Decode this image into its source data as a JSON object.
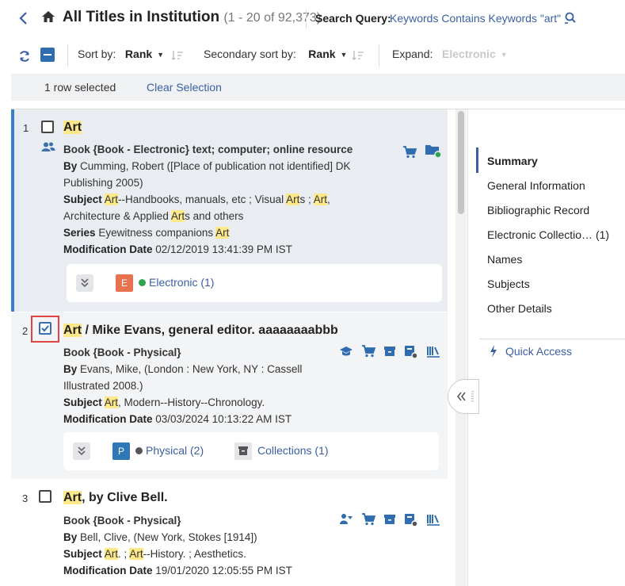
{
  "header": {
    "title": "All Titles in Institution",
    "count": "(1 - 20 of 92,373)",
    "search_query_label": "Search Query:",
    "search_query_value": "Keywords Contains Keywords \"art\""
  },
  "toolbar": {
    "sort_by_label": "Sort by:",
    "sort_by_value": "Rank",
    "secondary_sort_label": "Secondary sort by:",
    "secondary_sort_value": "Rank",
    "expand_label": "Expand:",
    "expand_value": "Electronic"
  },
  "selection": {
    "status": "1 row selected",
    "clear": "Clear Selection"
  },
  "results": [
    {
      "num": "1",
      "title_hl": "Art",
      "title_rest": "",
      "type_line": "Book {Book - Electronic} text; computer; online resource",
      "by_label": "By",
      "by_value_1": "Cumming, Robert ([Place of publication not identified] DK",
      "by_value_2": "Publishing 2005)",
      "subject_label": "Subject",
      "series_label": "Series",
      "series_value": "Eyewitness companions",
      "series_hl": "Art",
      "mod_label": "Modification Date",
      "mod_value": "02/12/2019 13:41:39 PM IST",
      "card_badge": "E",
      "card_link": "Electronic (1)",
      "color_badge": "#e8714f",
      "color_dot": "#2ea44f"
    },
    {
      "num": "2",
      "title_hl": "Art",
      "title_rest": " / Mike Evans, general editor. aaaaaaaabbb",
      "type_line": "Book {Book - Physical}",
      "by_label": "By",
      "by_value_1": "Evans, Mike, (London : New York, NY : Cassell",
      "by_value_2": "Illustrated 2008.)",
      "subject_label": "Subject",
      "subject_hl": "Art",
      "subject_rest": ", Modern--History--Chronology.",
      "mod_label": "Modification Date",
      "mod_value": "03/03/2024 10:13:22 AM IST",
      "card_badge": "P",
      "card_link": "Physical (2)",
      "card_link2": "Collections (1)",
      "color_badge": "#2f78b5",
      "color_dot": "#555555"
    },
    {
      "num": "3",
      "title_hl": "Art",
      "title_rest": ", by Clive Bell.",
      "type_line": "Book {Book - Physical}",
      "by_label": "By",
      "by_value_1": "Bell, Clive, (New York, Stokes [1914])",
      "subject_label": "Subject",
      "mod_label": "Modification Date",
      "mod_value": "19/01/2020 12:05:55 PM IST"
    }
  ],
  "nav": {
    "items": [
      "Summary",
      "General Information",
      "Bibliographic Record",
      "Electronic Collectio… (1)",
      "Names",
      "Subjects",
      "Other Details"
    ],
    "quick_access": "Quick Access"
  },
  "colors": {
    "accent": "#3a5fa5",
    "highlight": "#fde98a",
    "selected_border": "#3d7fc6"
  }
}
